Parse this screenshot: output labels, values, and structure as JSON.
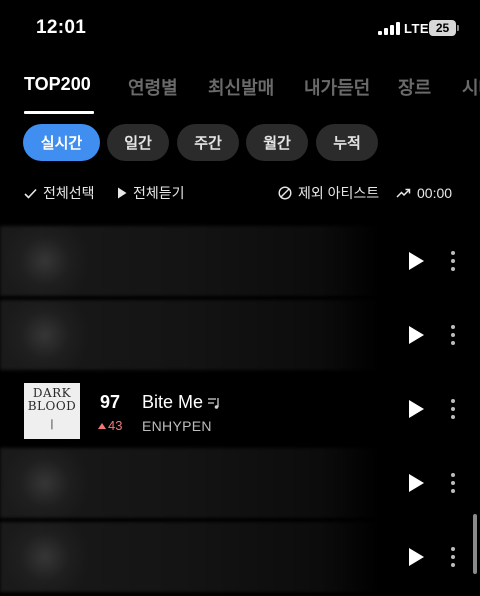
{
  "status_bar": {
    "time": "12:01",
    "network": "LTE",
    "battery": "25"
  },
  "tabs": [
    {
      "label": "TOP200",
      "active": true
    },
    {
      "label": "연령별",
      "active": false
    },
    {
      "label": "최신발매",
      "active": false
    },
    {
      "label": "내가듣던",
      "active": false
    },
    {
      "label": "장르",
      "active": false
    },
    {
      "label": "시대",
      "active": false
    }
  ],
  "period_chips": [
    {
      "label": "실시간",
      "active": true
    },
    {
      "label": "일간",
      "active": false
    },
    {
      "label": "주간",
      "active": false
    },
    {
      "label": "월간",
      "active": false
    },
    {
      "label": "누적",
      "active": false
    }
  ],
  "toolbar": {
    "select_all": "전체선택",
    "play_all": "전체듣기",
    "exclude_artist": "제외 아티스트",
    "chart_time": "00:00"
  },
  "featured_song": {
    "rank": "97",
    "rank_change": "43",
    "rank_change_direction": "up",
    "title": "Bite Me",
    "artist": "ENHYPEN",
    "album_art_text": "DARK BLOOD"
  },
  "colors": {
    "background": "#000000",
    "accent_blue": "#3f8ef0",
    "rank_up": "#f07878",
    "inactive_tab": "#6a6a6a"
  }
}
